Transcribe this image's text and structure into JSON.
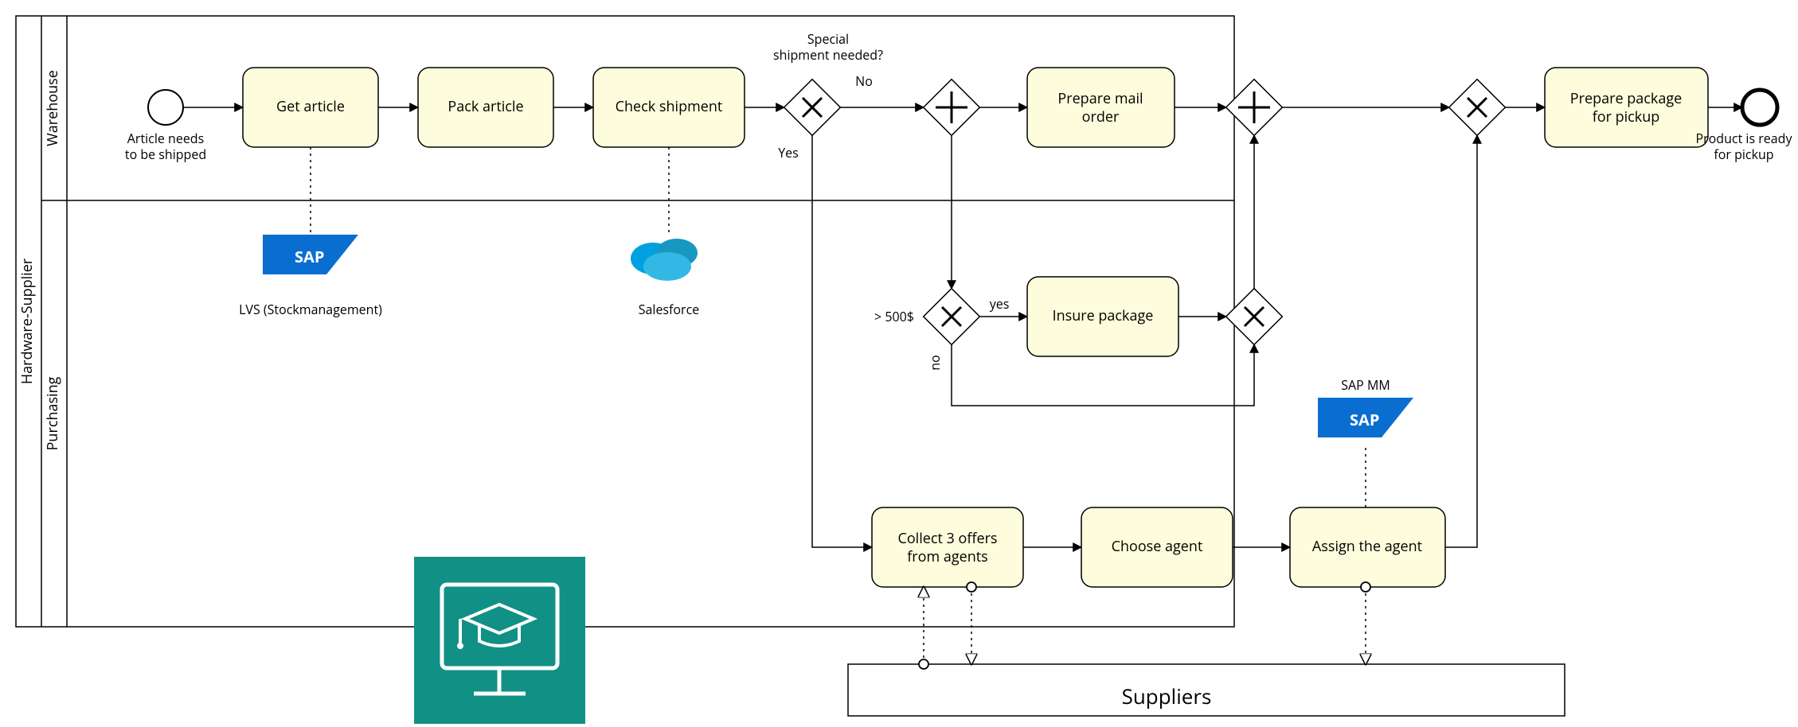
{
  "pool": {
    "title": "Hardware-Supplier",
    "lanes": {
      "warehouse": "Warehouse",
      "purchasing": "Purchasing"
    }
  },
  "events": {
    "start_label1": "Article needs",
    "start_label2": "to be shipped",
    "end_label1": "Product is ready",
    "end_label2": "for pickup"
  },
  "tasks": {
    "get_article": "Get article",
    "pack_article": "Pack article",
    "check_shipment": "Check shipment",
    "prepare_mail1": "Prepare mail",
    "prepare_mail2": "order",
    "insure_package": "Insure package",
    "collect_offers1": "Collect 3 offers",
    "collect_offers2": "from agents",
    "choose_agent": "Choose agent",
    "assign_agent": "Assign the agent",
    "prepare_pickup1": "Prepare package",
    "prepare_pickup2": "for pickup"
  },
  "gateways": {
    "special_shipment_q1": "Special",
    "special_shipment_q2": "shipment needed?",
    "no": "No",
    "yes": "Yes",
    "over500": "> 500$",
    "over500_yes": "yes",
    "over500_no": "no"
  },
  "datastores": {
    "lvs": "LVS (Stockmanagement)",
    "salesforce": "Salesforce",
    "sap_mm": "SAP MM"
  },
  "participants": {
    "suppliers": "Suppliers"
  }
}
